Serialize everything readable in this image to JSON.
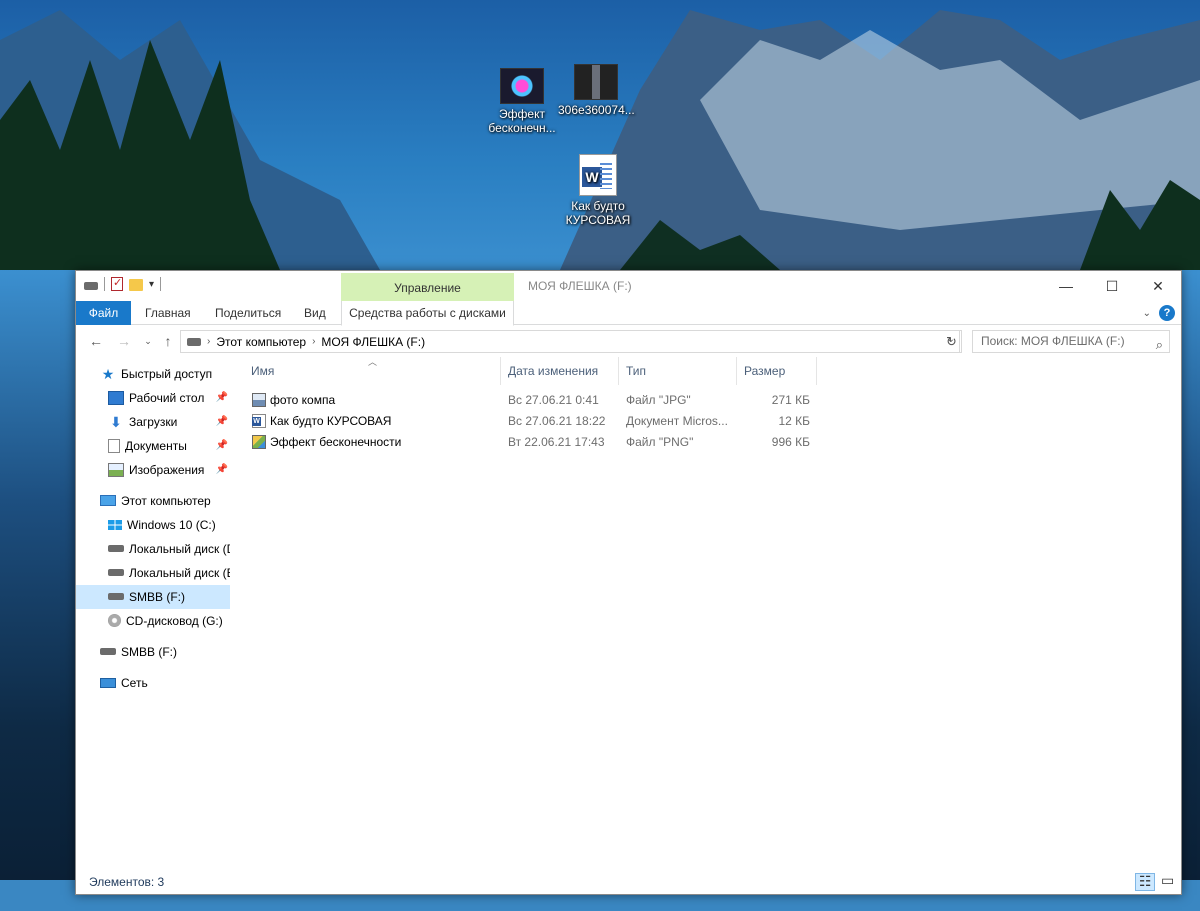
{
  "desktop": {
    "icons": [
      {
        "label": "Эффект бесконечн..."
      },
      {
        "label": "306e360074..."
      },
      {
        "label": "Как будто КУРСОВАЯ"
      }
    ]
  },
  "window": {
    "title": "МОЯ ФЛЕШКА (F:)",
    "contextual_group": "Управление",
    "controls": {
      "minimize": "—",
      "maximize": "☐",
      "close": "✕"
    }
  },
  "ribbon": {
    "tabs": [
      "Файл",
      "Главная",
      "Поделиться",
      "Вид",
      "Средства работы с дисками"
    ]
  },
  "address": {
    "crumbs": [
      "Этот компьютер",
      "МОЯ ФЛЕШКА (F:)"
    ],
    "search_placeholder": "Поиск: МОЯ ФЛЕШКА (F:)"
  },
  "nav": {
    "quick_access": "Быстрый доступ",
    "quick_items": [
      {
        "label": "Рабочий стол",
        "icon": "desktop-icon"
      },
      {
        "label": "Загрузки",
        "icon": "downloads-icon"
      },
      {
        "label": "Документы",
        "icon": "documents-icon"
      },
      {
        "label": "Изображения",
        "icon": "pictures-icon"
      }
    ],
    "this_pc": "Этот компьютер",
    "pc_items": [
      {
        "label": "Windows 10 (C:)"
      },
      {
        "label": "Локальный диск (D"
      },
      {
        "label": "Локальный диск (E"
      },
      {
        "label": "SMBB (F:)"
      },
      {
        "label": "CD-дисковод (G:)"
      }
    ],
    "removable": "SMBB (F:)",
    "network": "Сеть"
  },
  "list": {
    "columns": {
      "name": "Имя",
      "date": "Дата изменения",
      "type": "Тип",
      "size": "Размер"
    },
    "rows": [
      {
        "name": "фото компа",
        "date": "Вс 27.06.21 0:41",
        "type": "Файл \"JPG\"",
        "size": "271 КБ",
        "icon": "jpg-file-icon"
      },
      {
        "name": "Как будто КУРСОВАЯ",
        "date": "Вс 27.06.21 18:22",
        "type": "Документ Micros...",
        "size": "12 КБ",
        "icon": "word-file-icon"
      },
      {
        "name": "Эффект бесконечности",
        "date": "Вт 22.06.21 17:43",
        "type": "Файл \"PNG\"",
        "size": "996 КБ",
        "icon": "png-file-icon"
      }
    ]
  },
  "status": {
    "items_count": "Элементов: 3"
  }
}
